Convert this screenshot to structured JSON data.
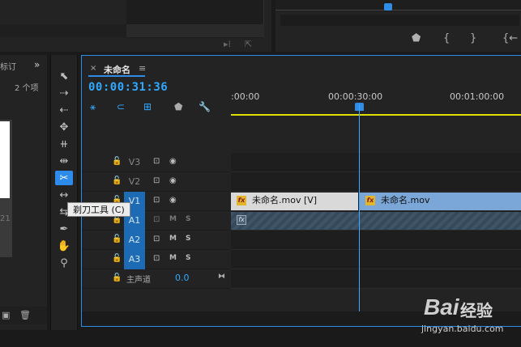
{
  "top_right": {
    "marker_icon": "marker-icon",
    "in_icon": "{",
    "out_icon": "}",
    "goto_in_icon": "{←"
  },
  "project": {
    "tab_label": "标订",
    "overflow": "»",
    "item_count": "2 个项",
    "thumb_num": "21"
  },
  "tools": {
    "tooltip": "剃刀工具 (C)"
  },
  "timeline": {
    "sequence_name": "未命名",
    "close": "×",
    "menu": "≡",
    "timecode": "00:00:31:36",
    "ruler_labels": [
      ":00:00",
      "00:00:30:00",
      "00:01:00:00"
    ],
    "tracks": [
      {
        "name": "V3",
        "kind": "video"
      },
      {
        "name": "V2",
        "kind": "video"
      },
      {
        "name": "V1",
        "kind": "video"
      },
      {
        "name": "A1",
        "kind": "audio"
      },
      {
        "name": "A2",
        "kind": "audio"
      },
      {
        "name": "A3",
        "kind": "audio"
      }
    ],
    "clips": {
      "v1_a": "未命名.mov [V]",
      "v1_b": "未命名.mov",
      "fx": "fx"
    },
    "audio_labels": {
      "m": "M",
      "s": "S"
    },
    "master": {
      "label": "主声道",
      "value": "0.0"
    }
  },
  "watermark": {
    "logo": "Bai",
    "brand": "经验",
    "url": "jingyan.baidu.com"
  }
}
